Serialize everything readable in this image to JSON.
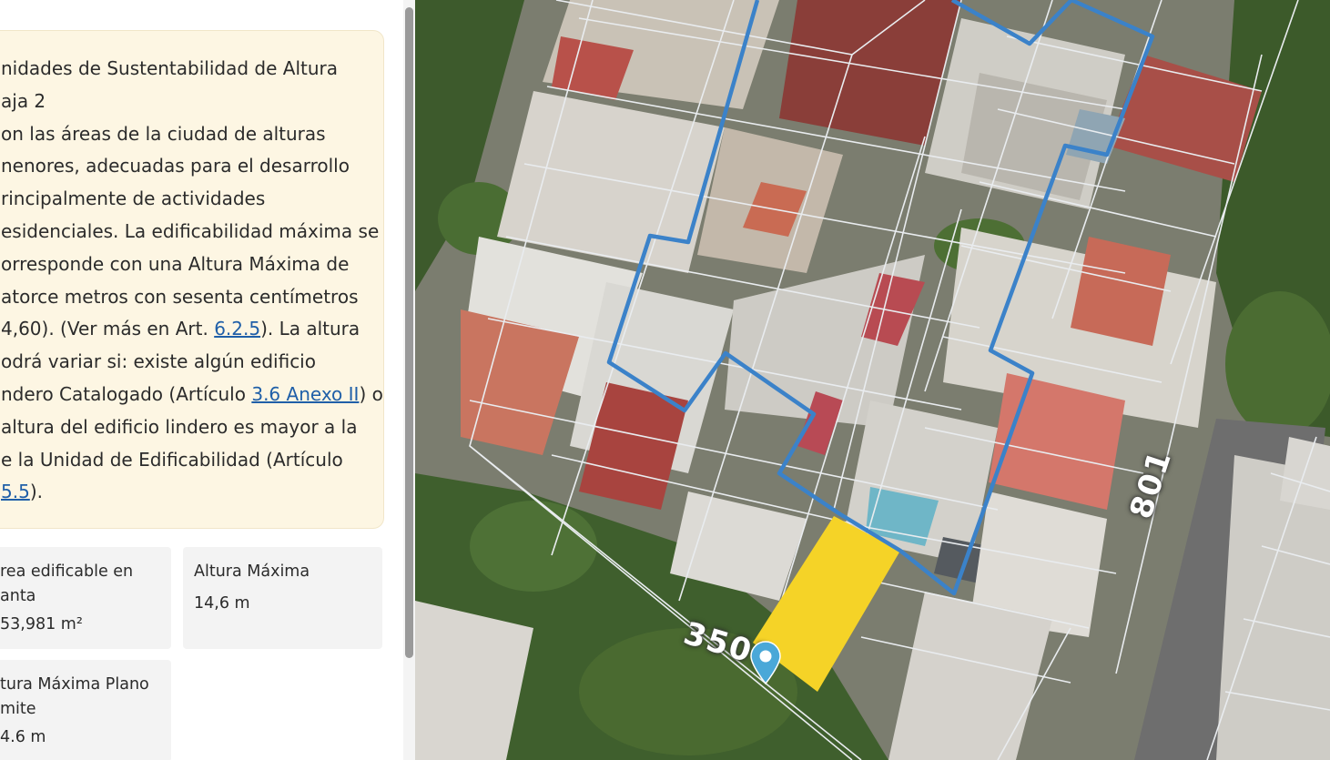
{
  "info": {
    "line1": "nidades de Sustentabilidad de Altura",
    "line2": "aja 2",
    "line3": "on las áreas de la ciudad de alturas",
    "line4": "nenores, adecuadas para el desarrollo",
    "line5": "rincipalmente de actividades",
    "line6": "esidenciales. La edificabilidad máxima se",
    "line7": "orresponde con una Altura Máxima de",
    "line8": "atorce metros con sesenta centímetros",
    "line9a": " 4,60). (Ver más en Art. ",
    "link1": "6.2.5",
    "line9b": "). La altura",
    "line10": "odrá variar si: existe algún edificio",
    "line11a": "ndero Catalogado (Artículo ",
    "link2": "3.6 Anexo II",
    "line11b": ") o",
    "line12": " altura del edificio lindero es mayor a la",
    "line13": "e la Unidad de Edificabilidad (Artículo",
    "link3": "5.5",
    "line14b": ")."
  },
  "stats": {
    "area_label": "rea edificable en planta",
    "area_label_l1": "rea edificable en",
    "area_label_l2": "anta",
    "area_value": "53,981 m²",
    "altura_label": "Altura Máxima",
    "altura_value": "14,6 m",
    "plano_label_l1": "tura Máxima Plano",
    "plano_label_l2": "mite",
    "plano_value": "4.6 m"
  },
  "map": {
    "street_number_1": "3501",
    "street_number_2": "801",
    "selected_parcel_color": "#f5d327",
    "block_outline_color": "#3b82c9",
    "marker_color": "#4aa8d8",
    "icons": [
      "location-marker-icon"
    ]
  }
}
